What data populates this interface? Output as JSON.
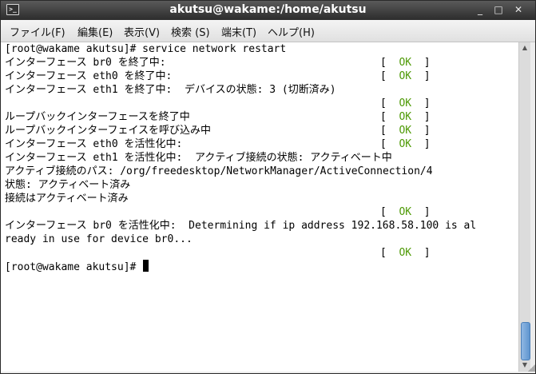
{
  "window": {
    "title": "akutsu@wakame:/home/akutsu",
    "minimize": "_",
    "maximize": "□",
    "close": "✕"
  },
  "menu": {
    "file": "ファイル(F)",
    "edit": "編集(E)",
    "view": "表示(V)",
    "search": "検索 (S)",
    "terminal": "端末(T)",
    "help": "ヘルプ(H)"
  },
  "terminal": {
    "lines": [
      "[root@wakame akutsu]# service network restart",
      "インターフェース br0 を終了中:",
      "インターフェース eth0 を終了中:",
      "インターフェース eth1 を終了中:  デバイスの状態: 3 (切断済み)",
      "",
      "ループバックインターフェースを終了中",
      "ループバックインターフェイスを呼び込み中",
      "インターフェース eth0 を活性化中:",
      "インターフェース eth1 を活性化中:  アクティブ接続の状態: アクティベート中",
      "アクティブ接続のパス: /org/freedesktop/NetworkManager/ActiveConnection/4",
      "状態: アクティベート済み",
      "接続はアクティベート済み",
      "",
      "インターフェース br0 を活性化中:  Determining if ip address 192.168.58.100 is al",
      "ready in use for device br0...",
      "",
      "[root@wakame akutsu]# "
    ],
    "status_open": "[",
    "status_ok": "OK",
    "status_close": "]"
  },
  "colors": {
    "ok": "#4e9a06",
    "scroll_thumb": "#5f95cf"
  }
}
